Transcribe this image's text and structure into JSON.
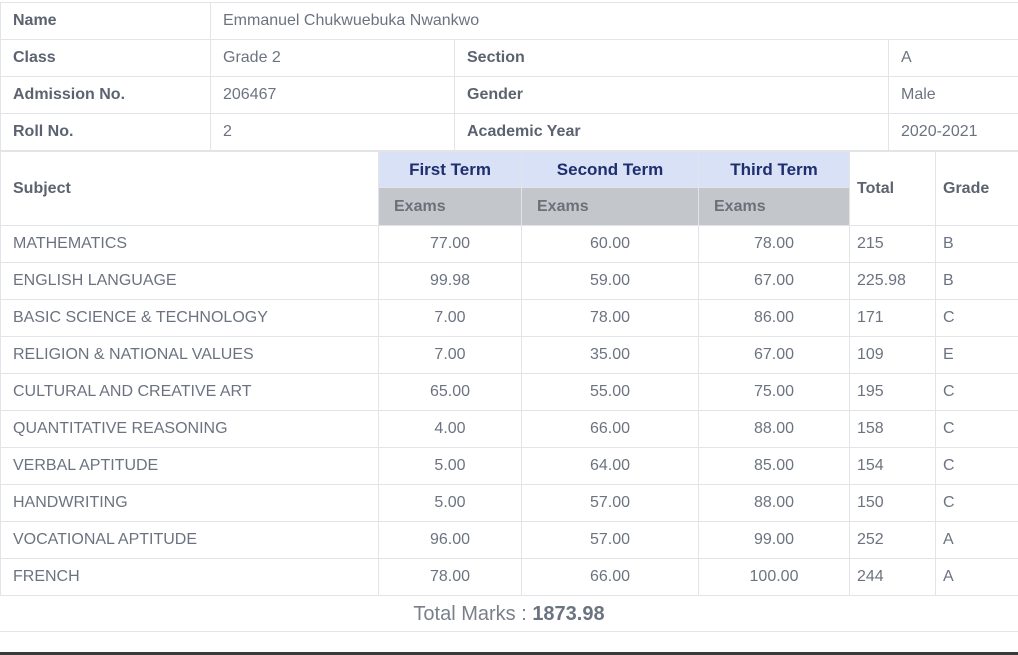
{
  "student": {
    "name_label": "Name",
    "name": "Emmanuel Chukwuebuka Nwankwo",
    "class_label": "Class",
    "class": "Grade 2",
    "section_label": "Section",
    "section": "A",
    "admission_label": "Admission No.",
    "admission": "206467",
    "gender_label": "Gender",
    "gender": "Male",
    "roll_label": "Roll No.",
    "roll": "2",
    "year_label": "Academic Year",
    "year": "2020-2021"
  },
  "marks": {
    "subject_header": "Subject",
    "terms": [
      "First Term",
      "Second Term",
      "Third Term"
    ],
    "exam_label": "Exams",
    "total_header": "Total",
    "grade_header": "Grade",
    "rows": [
      {
        "subject": "MATHEMATICS",
        "t1": "77.00",
        "t2": "60.00",
        "t3": "78.00",
        "total": "215",
        "grade": "B"
      },
      {
        "subject": "ENGLISH LANGUAGE",
        "t1": "99.98",
        "t2": "59.00",
        "t3": "67.00",
        "total": "225.98",
        "grade": "B"
      },
      {
        "subject": "BASIC SCIENCE & TECHNOLOGY",
        "t1": "7.00",
        "t2": "78.00",
        "t3": "86.00",
        "total": "171",
        "grade": "C"
      },
      {
        "subject": "RELIGION & NATIONAL VALUES",
        "t1": "7.00",
        "t2": "35.00",
        "t3": "67.00",
        "total": "109",
        "grade": "E"
      },
      {
        "subject": "CULTURAL AND CREATIVE ART",
        "t1": "65.00",
        "t2": "55.00",
        "t3": "75.00",
        "total": "195",
        "grade": "C"
      },
      {
        "subject": "QUANTITATIVE REASONING",
        "t1": "4.00",
        "t2": "66.00",
        "t3": "88.00",
        "total": "158",
        "grade": "C"
      },
      {
        "subject": "VERBAL APTITUDE",
        "t1": "5.00",
        "t2": "64.00",
        "t3": "85.00",
        "total": "154",
        "grade": "C"
      },
      {
        "subject": "HANDWRITING",
        "t1": "5.00",
        "t2": "57.00",
        "t3": "88.00",
        "total": "150",
        "grade": "C"
      },
      {
        "subject": "VOCATIONAL APTITUDE",
        "t1": "96.00",
        "t2": "57.00",
        "t3": "99.00",
        "total": "252",
        "grade": "A"
      },
      {
        "subject": "FRENCH",
        "t1": "78.00",
        "t2": "66.00",
        "t3": "100.00",
        "total": "244",
        "grade": "A"
      }
    ]
  },
  "summary": {
    "total_label": "Total Marks : ",
    "total_value": "1873.98"
  }
}
